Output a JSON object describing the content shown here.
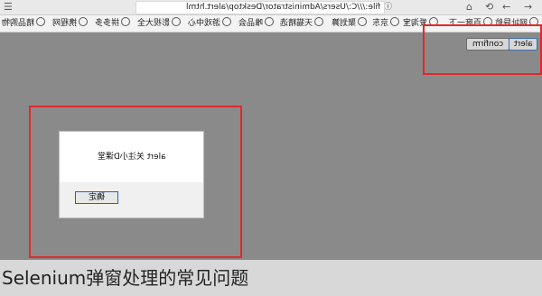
{
  "browser": {
    "address": "file:///C:/Users/Administrator/Desktop/alert.html",
    "nav_icons": [
      "back-icon",
      "forward-icon",
      "reload-icon",
      "home-icon",
      "info-icon"
    ]
  },
  "bookmarks": [
    {
      "label": "网址导航"
    },
    {
      "label": "百度一下"
    },
    {
      "label": "爱淘宝"
    },
    {
      "label": "京东"
    },
    {
      "label": "聚划算"
    },
    {
      "label": "天猫精选"
    },
    {
      "label": "唯品会"
    },
    {
      "label": "游戏中心"
    },
    {
      "label": "影视大全"
    },
    {
      "label": "拼多多"
    },
    {
      "label": "携程网"
    },
    {
      "label": "精品购物"
    }
  ],
  "page": {
    "alert_button": "alert",
    "confirm_button": "confirm"
  },
  "dialog": {
    "message": "alert 关注小D课堂",
    "ok_label": "确定"
  },
  "caption": "Selenium弹窗处理的常见问题",
  "colors": {
    "highlight": "#e22828",
    "overlay": "#8a8a8a",
    "dialog_focus": "#1a64c8"
  }
}
